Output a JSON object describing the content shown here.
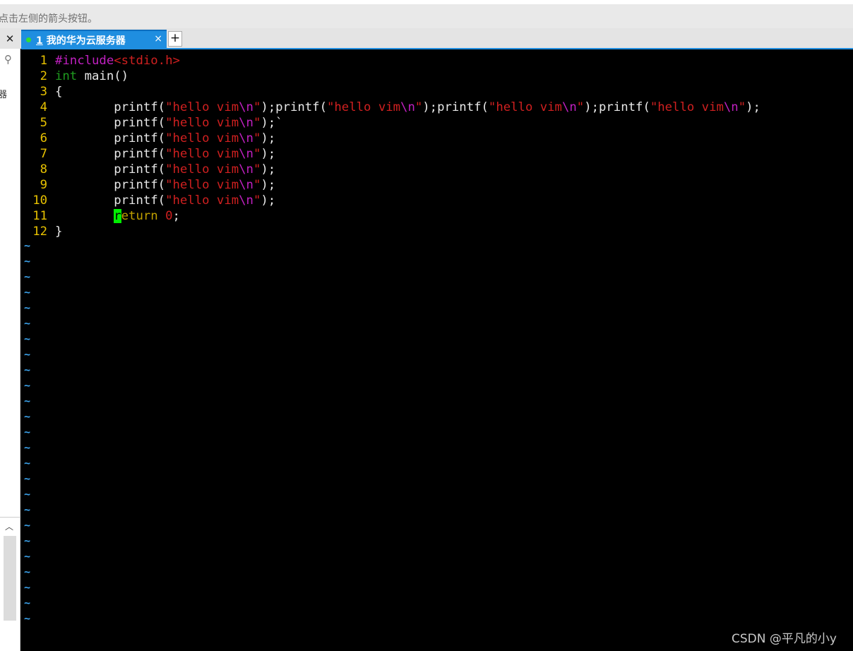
{
  "hint": {
    "text": "点击左侧的箭头按钮。"
  },
  "side_panel": {
    "close_glyph": "✕",
    "search_glyph": "⚲",
    "partial_label": "器",
    "scroll_up_glyph": "︿"
  },
  "tab": {
    "number": "1",
    "title": "我的华为云服务器",
    "close_glyph": "×",
    "status_color": "#33dd33"
  },
  "new_tab": {
    "glyph": "+"
  },
  "editor": {
    "line_numbers": [
      "1",
      "2",
      "3",
      "4",
      "5",
      "6",
      "7",
      "8",
      "9",
      "10",
      "11",
      "12"
    ],
    "code": {
      "l1_directive": "#include",
      "l1_header": "<stdio.h>",
      "l2_type": "int",
      "l2_rest": " main()",
      "l3_text": "{",
      "indent": "        ",
      "func": "printf",
      "open_paren": "(",
      "quote": "\"",
      "str_text": "hello vim",
      "escape": "\\n",
      "close_stmt": ");",
      "l5_trailing": "`",
      "l11_cursor_char": "r",
      "l11_keyword_rest": "eturn",
      "l11_number": "0",
      "l11_semicolon": ";",
      "l12_text": "}"
    },
    "tilde": "~",
    "colors": {
      "line_number": "#e8c200",
      "string": "#d02020",
      "escape": "#c020c0",
      "cursor": "#00ee00",
      "tilde": "#3aa0e8"
    }
  },
  "watermark": {
    "text": "CSDN @平凡的小y"
  }
}
